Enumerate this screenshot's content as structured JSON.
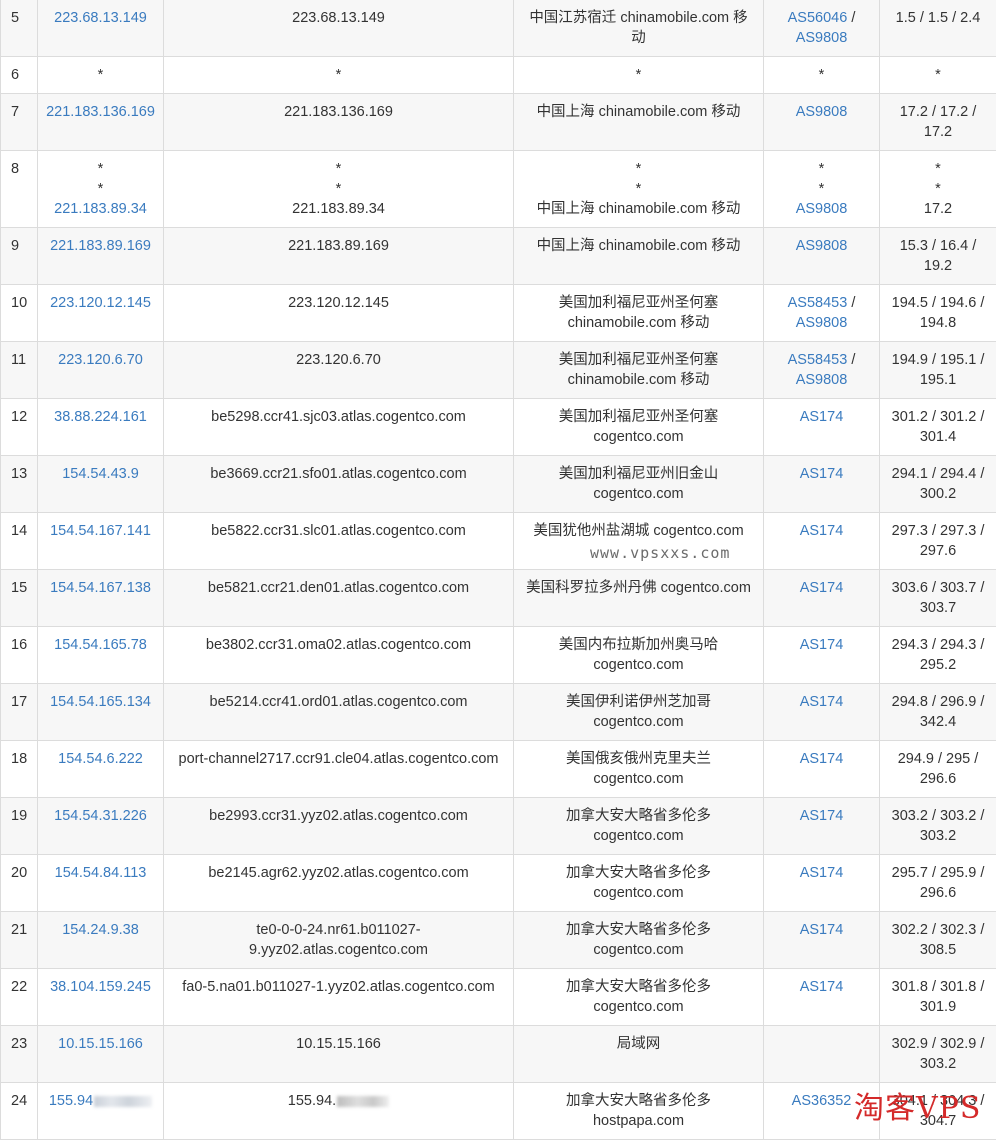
{
  "rows": [
    {
      "hop": "5",
      "ip": "223.68.13.149",
      "host": "223.68.13.149",
      "loc": [
        "中国江苏宿迁 chinamobile.com 移",
        "动"
      ],
      "asn": [
        "AS56046 /",
        "AS9808"
      ],
      "lat": [
        "1.5 / 1.5 / 2.4"
      ]
    },
    {
      "hop": "6",
      "ip": "*",
      "host": "*",
      "loc": [
        "*"
      ],
      "asn": [
        "*"
      ],
      "lat": [
        "*"
      ]
    },
    {
      "hop": "7",
      "ip": "221.183.136.169",
      "host": "221.183.136.169",
      "loc": [
        "中国上海 chinamobile.com 移动"
      ],
      "asn": [
        "AS9808"
      ],
      "lat": [
        "17.2 / 17.2 /",
        "17.2"
      ]
    },
    {
      "hop": "8",
      "ip_lines": [
        "*",
        "*",
        "221.183.89.34"
      ],
      "host_lines": [
        "*",
        "*",
        "221.183.89.34"
      ],
      "loc": [
        "*",
        "*",
        "中国上海 chinamobile.com 移动"
      ],
      "asn": [
        "*",
        "*",
        "AS9808"
      ],
      "lat": [
        "*",
        "*",
        "17.2"
      ]
    },
    {
      "hop": "9",
      "ip": "221.183.89.169",
      "host": "221.183.89.169",
      "loc": [
        "中国上海 chinamobile.com 移动"
      ],
      "asn": [
        "AS9808"
      ],
      "lat": [
        "15.3 / 16.4 /",
        "19.2"
      ]
    },
    {
      "hop": "10",
      "ip": "223.120.12.145",
      "host": "223.120.12.145",
      "loc": [
        "美国加利福尼亚州圣何塞",
        "chinamobile.com 移动"
      ],
      "asn": [
        "AS58453 /",
        "AS9808"
      ],
      "lat": [
        "194.5 / 194.6 /",
        "194.8"
      ]
    },
    {
      "hop": "11",
      "ip": "223.120.6.70",
      "host": "223.120.6.70",
      "loc": [
        "美国加利福尼亚州圣何塞",
        "chinamobile.com 移动"
      ],
      "asn": [
        "AS58453 /",
        "AS9808"
      ],
      "lat": [
        "194.9 / 195.1 /",
        "195.1"
      ]
    },
    {
      "hop": "12",
      "ip": "38.88.224.161",
      "host": "be5298.ccr41.sjc03.atlas.cogentco.com",
      "loc": [
        "美国加利福尼亚州圣何塞",
        "cogentco.com"
      ],
      "asn": [
        "AS174"
      ],
      "lat": [
        "301.2 / 301.2 /",
        "301.4"
      ]
    },
    {
      "hop": "13",
      "ip": "154.54.43.9",
      "host": "be3669.ccr21.sfo01.atlas.cogentco.com",
      "loc": [
        "美国加利福尼亚州旧金山",
        "cogentco.com"
      ],
      "asn": [
        "AS174"
      ],
      "lat": [
        "294.1 / 294.4 /",
        "300.2"
      ]
    },
    {
      "hop": "14",
      "ip": "154.54.167.141",
      "host": "be5822.ccr31.slc01.atlas.cogentco.com",
      "loc": [
        "美国犹他州盐湖城 cogentco.com"
      ],
      "asn": [
        "AS174"
      ],
      "lat": [
        "297.3 / 297.3 /",
        "297.6"
      ]
    },
    {
      "hop": "15",
      "ip": "154.54.167.138",
      "host": "be5821.ccr21.den01.atlas.cogentco.com",
      "loc": [
        "美国科罗拉多州丹佛 cogentco.com"
      ],
      "asn": [
        "AS174"
      ],
      "lat": [
        "303.6 / 303.7 /",
        "303.7"
      ]
    },
    {
      "hop": "16",
      "ip": "154.54.165.78",
      "host": "be3802.ccr31.oma02.atlas.cogentco.com",
      "loc": [
        "美国内布拉斯加州奥马哈",
        "cogentco.com"
      ],
      "asn": [
        "AS174"
      ],
      "lat": [
        "294.3 / 294.3 /",
        "295.2"
      ]
    },
    {
      "hop": "17",
      "ip": "154.54.165.134",
      "host": "be5214.ccr41.ord01.atlas.cogentco.com",
      "loc": [
        "美国伊利诺伊州芝加哥",
        "cogentco.com"
      ],
      "asn": [
        "AS174"
      ],
      "lat": [
        "294.8 / 296.9 /",
        "342.4"
      ]
    },
    {
      "hop": "18",
      "ip": "154.54.6.222",
      "host": "port-channel2717.ccr91.cle04.atlas.cogentco.com",
      "loc": [
        "美国俄亥俄州克里夫兰",
        "cogentco.com"
      ],
      "asn": [
        "AS174"
      ],
      "lat": [
        "294.9 / 295 /",
        "296.6"
      ]
    },
    {
      "hop": "19",
      "ip": "154.54.31.226",
      "host": "be2993.ccr31.yyz02.atlas.cogentco.com",
      "loc": [
        "加拿大安大略省多伦多",
        "cogentco.com"
      ],
      "asn": [
        "AS174"
      ],
      "lat": [
        "303.2 / 303.2 /",
        "303.2"
      ]
    },
    {
      "hop": "20",
      "ip": "154.54.84.113",
      "host": "be2145.agr62.yyz02.atlas.cogentco.com",
      "loc": [
        "加拿大安大略省多伦多",
        "cogentco.com"
      ],
      "asn": [
        "AS174"
      ],
      "lat": [
        "295.7 / 295.9 /",
        "296.6"
      ]
    },
    {
      "hop": "21",
      "ip": "154.24.9.38",
      "host": "te0-0-0-24.nr61.b011027-\n9.yyz02.atlas.cogentco.com",
      "loc": [
        "加拿大安大略省多伦多",
        "cogentco.com"
      ],
      "asn": [
        "AS174"
      ],
      "lat": [
        "302.2 / 302.3 /",
        "308.5"
      ]
    },
    {
      "hop": "22",
      "ip": "38.104.159.245",
      "host": "fa0-5.na01.b011027-1.yyz02.atlas.cogentco.com",
      "loc": [
        "加拿大安大略省多伦多",
        "cogentco.com"
      ],
      "asn": [
        "AS174"
      ],
      "lat": [
        "301.8 / 301.8 /",
        "301.9"
      ]
    },
    {
      "hop": "23",
      "ip": "10.15.15.166",
      "host": "10.15.15.166",
      "loc": [
        "局域网"
      ],
      "asn": [
        ""
      ],
      "lat": [
        "302.9 / 302.9 /",
        "303.2"
      ]
    },
    {
      "hop": "24",
      "ip": "155.94",
      "ip_redacted": true,
      "host": "155.94.",
      "host_redacted": true,
      "loc": [
        "加拿大安大略省多伦多",
        "hostpapa.com"
      ],
      "asn": [
        "AS36352"
      ],
      "lat": [
        "304.1 / 304.3 /",
        "304.7"
      ]
    }
  ],
  "watermark_site": "www.vpsxxs.com",
  "watermark_brand": "淘客VPS"
}
